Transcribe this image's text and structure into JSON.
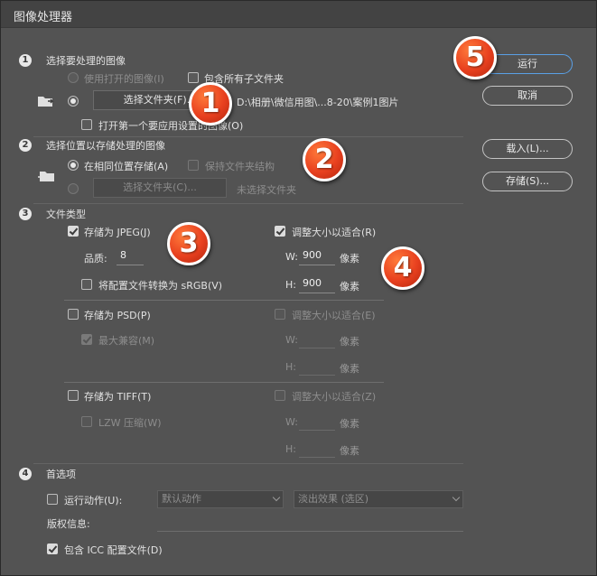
{
  "window": {
    "title": "图像处理器"
  },
  "sections": {
    "s1": {
      "num": "1",
      "title": "选择要处理的图像",
      "use_open": "使用打开的图像(I)",
      "include_sub": "包含所有子文件夹",
      "select_folder": "选择文件夹(F)...",
      "path": "D:\\相册\\微信用图\\...8-20\\案例1图片",
      "open_first": "打开第一个要应用设置的图像(O)"
    },
    "s2": {
      "num": "2",
      "title": "选择位置以存储处理的图像",
      "same_location": "在相同位置存储(A)",
      "keep_structure": "保持文件夹结构",
      "select_folder": "选择文件夹(C)...",
      "no_folder": "未选择文件夹"
    },
    "s3": {
      "num": "3",
      "title": "文件类型",
      "jpeg": {
        "save_label": "存储为 JPEG(J)",
        "quality_label": "品质:",
        "quality_value": "8",
        "convert_srgb": "将配置文件转换为 sRGB(V)",
        "resize_label": "调整大小以适合(R)",
        "w_label": "W:",
        "w_value": "900",
        "h_label": "H:",
        "h_value": "900",
        "unit": "像素"
      },
      "psd": {
        "save_label": "存储为 PSD(P)",
        "max_compat": "最大兼容(M)",
        "resize_label": "调整大小以适合(E)",
        "w_label": "W:",
        "h_label": "H:",
        "unit": "像素"
      },
      "tiff": {
        "save_label": "存储为 TIFF(T)",
        "lzw": "LZW 压缩(W)",
        "resize_label": "调整大小以适合(Z)",
        "w_label": "W:",
        "h_label": "H:",
        "unit": "像素"
      }
    },
    "s4": {
      "num": "4",
      "title": "首选项",
      "run_action": "运行动作(U):",
      "action_set": "默认动作",
      "action": "淡出效果 (选区)",
      "copyright": "版权信息:",
      "icc": "包含 ICC 配置文件(D)"
    }
  },
  "buttons": {
    "run": "运行",
    "cancel": "取消",
    "load": "载入(L)...",
    "save": "存储(S)..."
  },
  "badges": [
    "1",
    "2",
    "3",
    "4",
    "5"
  ]
}
